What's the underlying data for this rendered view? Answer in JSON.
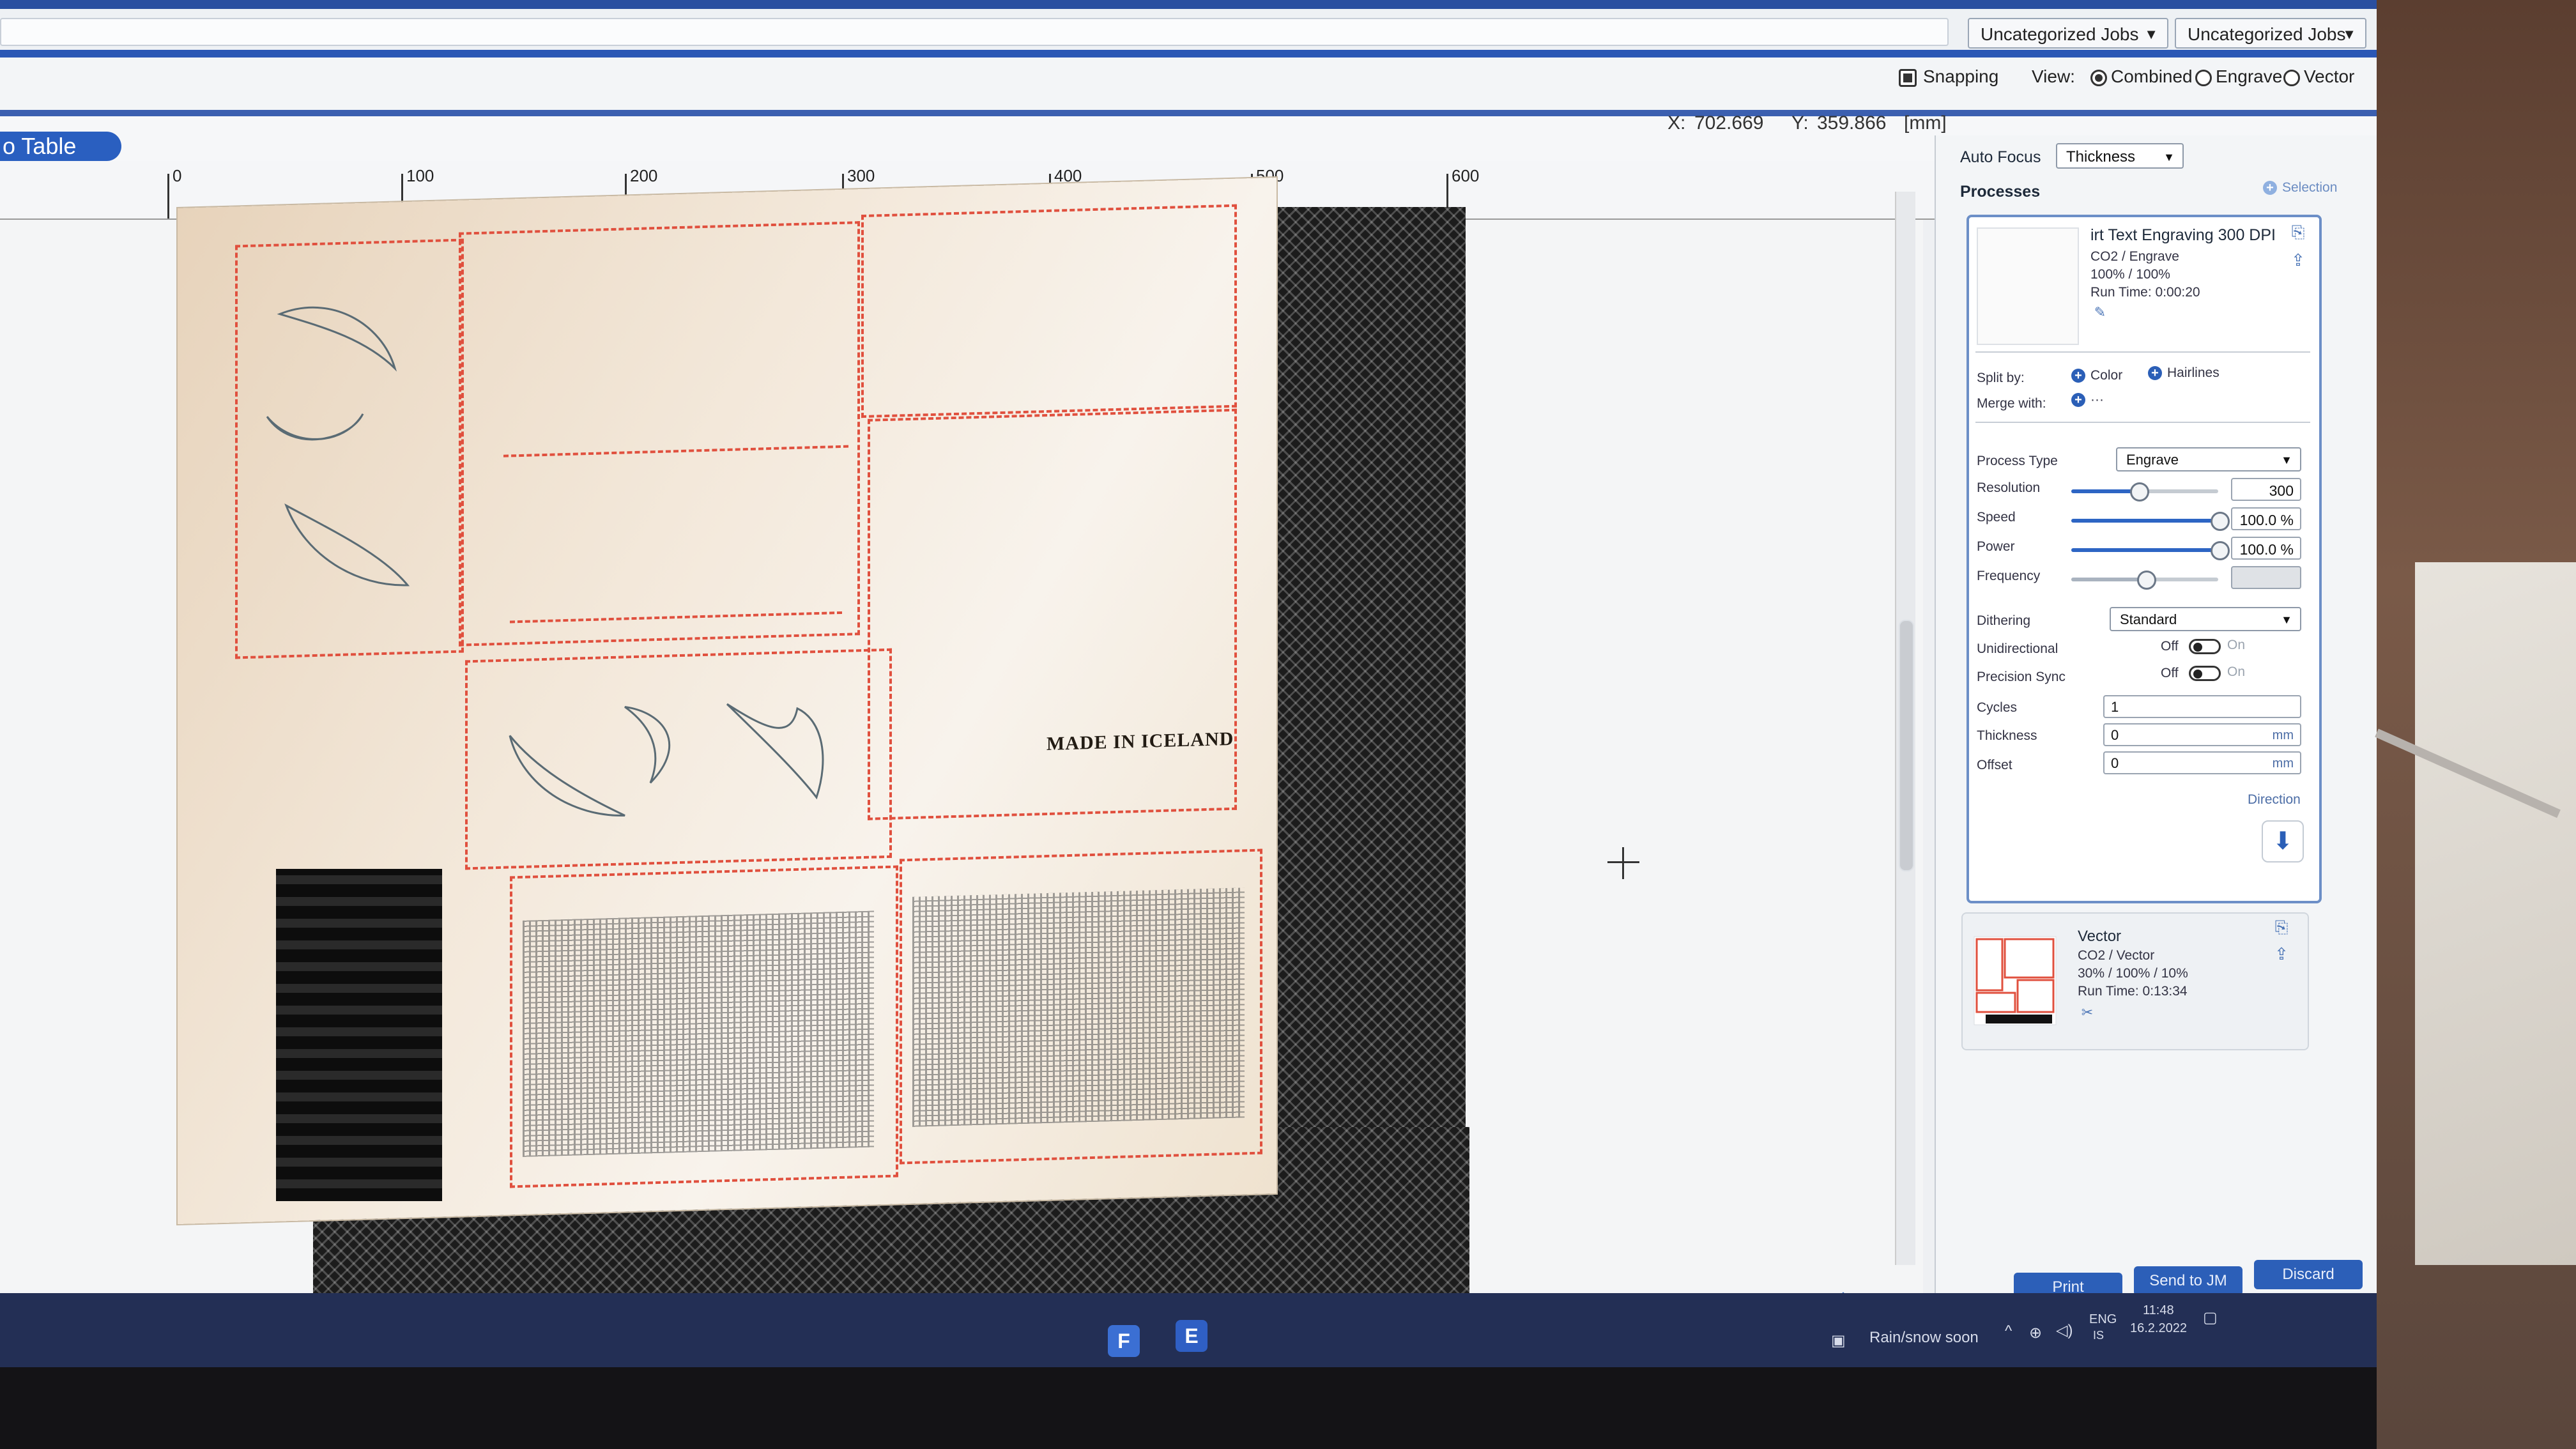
{
  "header": {
    "job_dropdown_1": "Uncategorized Jobs",
    "job_dropdown_2": "Uncategorized Jobs"
  },
  "toolbar": {
    "snapping_label": "Snapping",
    "snapping_checked": true,
    "view_label": "View:",
    "view_options": [
      "Combined",
      "Engrave",
      "Vector"
    ],
    "view_selected": "Combined"
  },
  "workspace": {
    "tab_label": "o Table",
    "x_label": "X:",
    "x_value": "702.669",
    "y_label": "Y:",
    "y_value": "359.866",
    "unit_label": "[mm]",
    "ruler_ticks": [
      "0",
      "100",
      "200",
      "300",
      "400",
      "500",
      "600"
    ],
    "engraving_text": "MADE IN ICELAND"
  },
  "panel": {
    "auto_focus_label": "Auto Focus",
    "auto_focus_value": "Thickness",
    "processes_label": "Processes",
    "selection_label": "Selection",
    "process1": {
      "name": "irt Text Engraving 300 DPI",
      "type": "CO2 / Engrave",
      "power": "100% / 100%",
      "runtime": "Run Time: 0:00:20"
    },
    "split_by_label": "Split by:",
    "split_color": "Color",
    "split_hairlines": "Hairlines",
    "merge_with_label": "Merge with:",
    "merge_more": "···",
    "process_type_label": "Process Type",
    "process_type_value": "Engrave",
    "resolution_label": "Resolution",
    "resolution_value": "300",
    "speed_label": "Speed",
    "speed_value": "100.0 %",
    "power_label": "Power",
    "power_value": "100.0 %",
    "frequency_label": "Frequency",
    "dithering_label": "Dithering",
    "dithering_value": "Standard",
    "unidirectional_label": "Unidirectional",
    "precision_sync_label": "Precision Sync",
    "toggle_off": "Off",
    "toggle_on": "On",
    "cycles_label": "Cycles",
    "cycles_value": "1",
    "thickness_label": "Thickness",
    "thickness_value": "0",
    "offset_label": "Offset",
    "offset_value": "0",
    "unit_mm": "mm",
    "direction_label": "Direction",
    "process2": {
      "name": "Vector",
      "type": "CO2 / Vector",
      "power": "30% / 100% / 10%",
      "runtime": "Run Time: 0:13:34"
    },
    "print_label": "Print",
    "send_label": "Send to JM",
    "discard_label": "Discard"
  },
  "sliders": {
    "resolution_fraction": 0.45,
    "speed_fraction": 1.0,
    "power_fraction": 1.0,
    "frequency_fraction": 0.5
  },
  "taskbar": {
    "weather": "Rain/snow soon",
    "lang": "ENG",
    "lang_sub": "IS",
    "time": "11:48",
    "date": "16.2.2022"
  },
  "colors": {
    "accent": "#2c5fb8",
    "cut_line": "#e0503e"
  }
}
